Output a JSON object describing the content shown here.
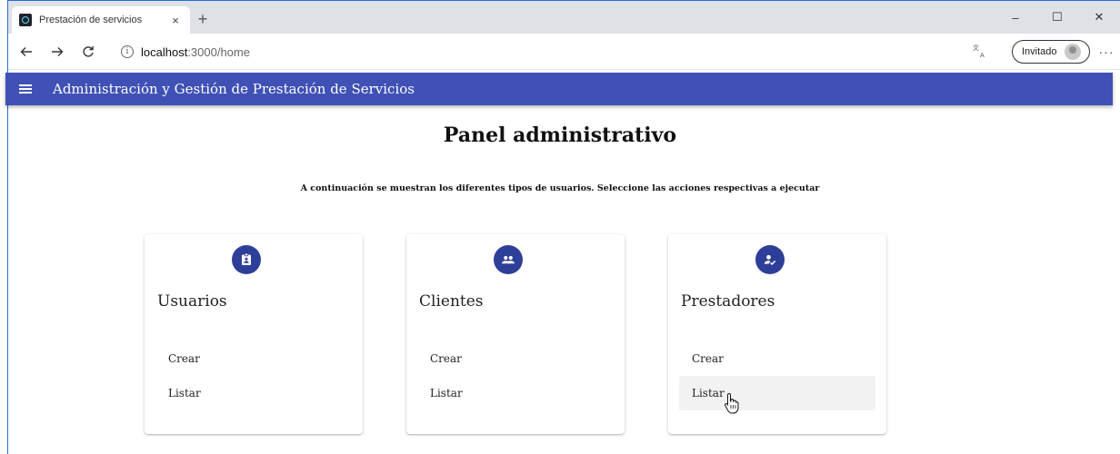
{
  "browser": {
    "tab_title": "Prestación de servicios",
    "tab_close": "×",
    "new_tab": "+",
    "window_controls": {
      "minimize": "–",
      "maximize": "☐",
      "close": "✕"
    },
    "url_host": "localhost",
    "url_path": ":3000/home",
    "profile_label": "Invitado",
    "more_label": "···"
  },
  "appbar": {
    "title": "Administración y Gestión de Prestación de Servicios"
  },
  "page": {
    "title": "Panel administrativo",
    "subtitle": "A continuación se muestran los diferentes tipos de usuarios. Seleccione las acciones respectivas a ejecutar"
  },
  "cards": [
    {
      "title": "Usuarios",
      "icon": "badge-icon",
      "actions": [
        "Crear",
        "Listar"
      ]
    },
    {
      "title": "Clientes",
      "icon": "people-icon",
      "actions": [
        "Crear",
        "Listar"
      ]
    },
    {
      "title": "Prestadores",
      "icon": "how-to-reg-icon",
      "actions": [
        "Crear",
        "Listar"
      ]
    }
  ],
  "colors": {
    "appbar": "#3f51b5",
    "icon_bg": "#2e3f99"
  }
}
